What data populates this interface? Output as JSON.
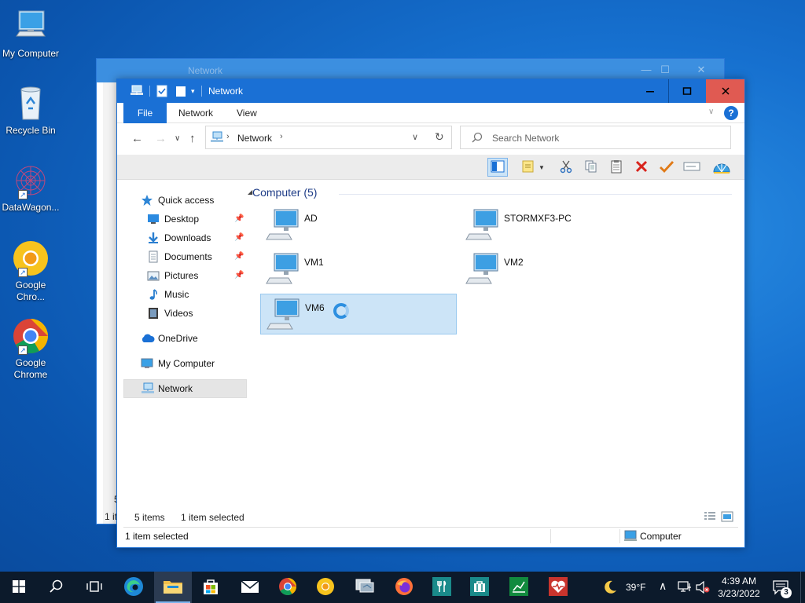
{
  "desktop": {
    "icons": [
      {
        "label": "My Computer"
      },
      {
        "label": "Recycle Bin"
      },
      {
        "label": "DataWagon..."
      },
      {
        "label": "Google Chro..."
      },
      {
        "label": "Google Chrome"
      }
    ]
  },
  "back_window": {
    "title": "Network",
    "status_fragment": "5",
    "status_fragment2": "1 it"
  },
  "window": {
    "title": "Network",
    "controls": {
      "minimize": "—",
      "maximize": "☐",
      "close": "✕"
    },
    "ribbon_tabs": [
      {
        "label": "File"
      },
      {
        "label": "Network"
      },
      {
        "label": "View"
      }
    ],
    "help_label": "?",
    "address": {
      "crumb": "Network"
    },
    "search": {
      "placeholder": "Search Network"
    },
    "sidebar": [
      {
        "label": "Quick access"
      },
      {
        "label": "Desktop",
        "pinned": true
      },
      {
        "label": "Downloads",
        "pinned": true
      },
      {
        "label": "Documents",
        "pinned": true
      },
      {
        "label": "Pictures",
        "pinned": true
      },
      {
        "label": "Music"
      },
      {
        "label": "Videos"
      },
      {
        "label": "OneDrive"
      },
      {
        "label": "My Computer"
      },
      {
        "label": "Network",
        "selected": true
      }
    ],
    "group_header": "Computer (5)",
    "items": [
      {
        "name": "AD"
      },
      {
        "name": "STORMXF3-PC"
      },
      {
        "name": "VM1"
      },
      {
        "name": "VM2"
      },
      {
        "name": "VM6",
        "selected": true,
        "loading": true
      }
    ],
    "inner_status": {
      "count": "5 items",
      "selection": "1 item selected"
    },
    "status": {
      "left": "1 item selected",
      "right": "Computer"
    }
  },
  "taskbar": {
    "weather": "39°F",
    "time": "4:39 AM",
    "date": "3/23/2022",
    "notifications": "3",
    "apps": [
      "start",
      "search",
      "task-view",
      "edge",
      "file-explorer",
      "store",
      "mail",
      "chrome",
      "chrome-canary",
      "remote-desktop",
      "firefox",
      "app-tool",
      "app-briefcase",
      "app-chart",
      "app-health"
    ]
  },
  "colors": {
    "accent": "#1a70d5",
    "close": "#e05a52",
    "selection": "#cce4f7",
    "group_header": "#1e3c87"
  }
}
